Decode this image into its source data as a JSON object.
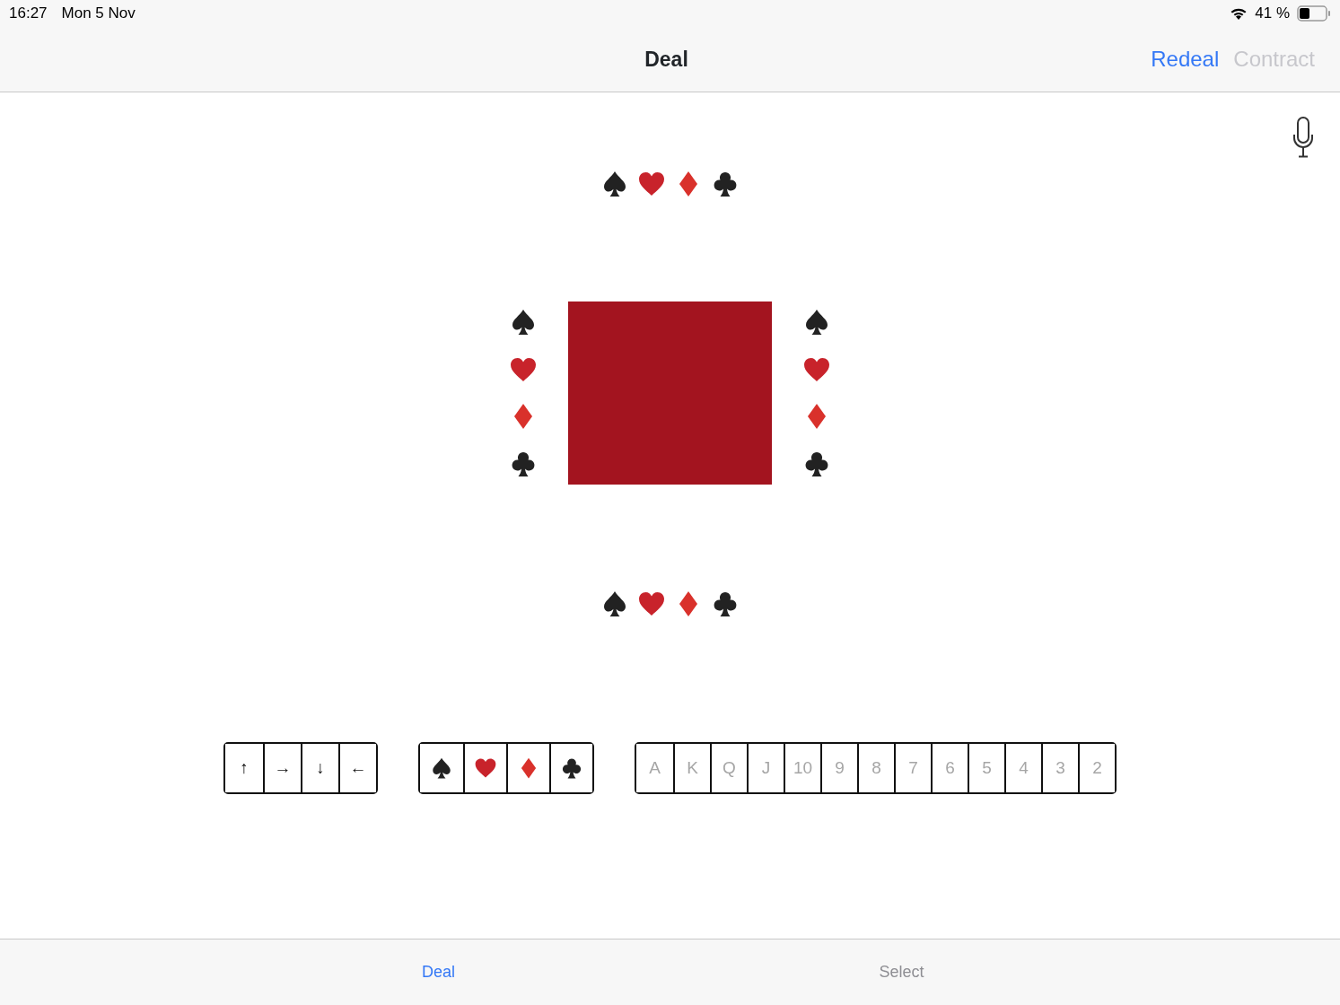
{
  "status_bar": {
    "time": "16:27",
    "date": "Mon 5 Nov",
    "battery": "41 %"
  },
  "nav_bar": {
    "title": "Deal",
    "buttons": [
      {
        "label": "Redeal",
        "disabled": false
      },
      {
        "label": "Contract",
        "disabled": true
      }
    ]
  },
  "hands": {
    "north": [
      {
        "kind": "spade"
      },
      {
        "kind": "heart"
      },
      {
        "kind": "diamond"
      },
      {
        "kind": "club"
      }
    ],
    "west": [
      {
        "kind": "spade"
      },
      {
        "kind": "heart"
      },
      {
        "kind": "diamond"
      },
      {
        "kind": "club"
      }
    ],
    "east": [
      {
        "kind": "spade"
      },
      {
        "kind": "heart"
      },
      {
        "kind": "diamond"
      },
      {
        "kind": "club"
      }
    ],
    "south": [
      {
        "kind": "spade"
      },
      {
        "kind": "heart"
      },
      {
        "kind": "diamond"
      },
      {
        "kind": "club"
      }
    ]
  },
  "direction_buttons": [
    {
      "label": "↑"
    },
    {
      "label": "→"
    },
    {
      "label": "↓"
    },
    {
      "label": "←"
    }
  ],
  "suit_buttons": [
    {
      "kind": "spade"
    },
    {
      "kind": "heart"
    },
    {
      "kind": "diamond"
    },
    {
      "kind": "club"
    }
  ],
  "rank_buttons": [
    {
      "label": "A",
      "disabled": true
    },
    {
      "label": "K",
      "disabled": true
    },
    {
      "label": "Q",
      "disabled": true
    },
    {
      "label": "J",
      "disabled": true
    },
    {
      "label": "10",
      "disabled": true
    },
    {
      "label": "9",
      "disabled": true
    },
    {
      "label": "8",
      "disabled": true
    },
    {
      "label": "7",
      "disabled": true
    },
    {
      "label": "6",
      "disabled": true
    },
    {
      "label": "5",
      "disabled": true
    },
    {
      "label": "4",
      "disabled": true
    },
    {
      "label": "3",
      "disabled": true
    },
    {
      "label": "2",
      "disabled": true
    }
  ],
  "tabs": [
    {
      "label": "Deal",
      "selected": true
    },
    {
      "label": "Select",
      "selected": false
    }
  ]
}
